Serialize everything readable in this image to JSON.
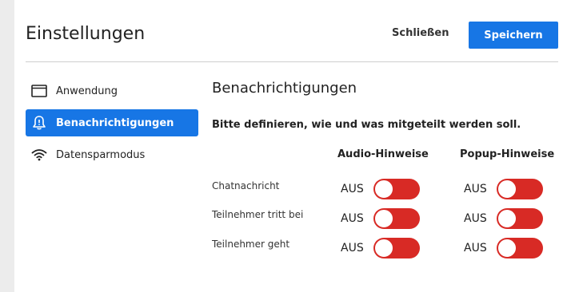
{
  "header": {
    "title": "Einstellungen",
    "close_label": "Schließen",
    "save_label": "Speichern"
  },
  "sidebar": {
    "items": [
      {
        "label": "Anwendung",
        "icon": "window-icon",
        "active": false
      },
      {
        "label": "Benachrichtigungen",
        "icon": "bell-icon",
        "active": true
      },
      {
        "label": "Datensparmodus",
        "icon": "wifi-icon",
        "active": false
      }
    ]
  },
  "main": {
    "title": "Benachrichtigungen",
    "description": "Bitte definieren, wie und was mitgeteilt werden soll.",
    "columns": [
      "Audio-Hinweise",
      "Popup-Hinweise"
    ],
    "rows": [
      {
        "label": "Chatnachricht",
        "audio": "AUS",
        "popup": "AUS"
      },
      {
        "label": "Teilnehmer tritt bei",
        "audio": "AUS",
        "popup": "AUS"
      },
      {
        "label": "Teilnehmer geht",
        "audio": "AUS",
        "popup": "AUS"
      }
    ]
  },
  "colors": {
    "accent": "#1776e5",
    "toggle_off": "#d82a25"
  }
}
